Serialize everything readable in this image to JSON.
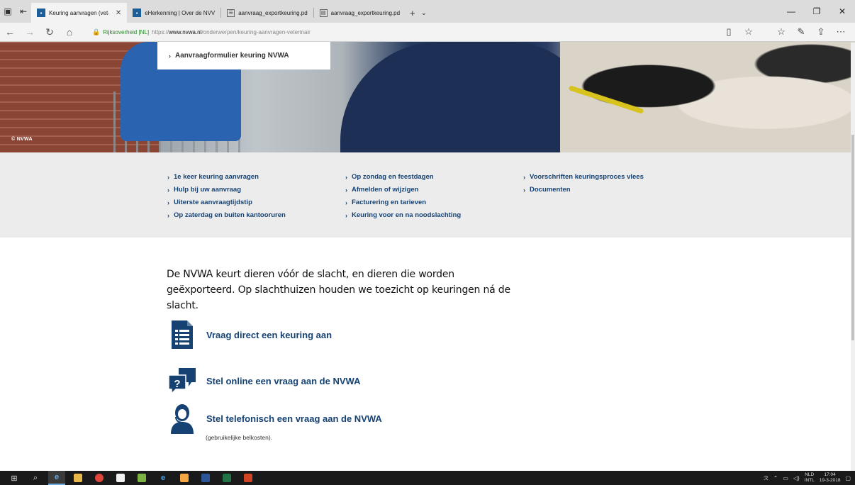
{
  "browser": {
    "tabs": [
      {
        "label": "Keuring aanvragen (vet·",
        "active": true,
        "icon": "nvwa-favicon"
      },
      {
        "label": "eHerkenning | Over de NVV",
        "active": false,
        "icon": "nvwa-favicon"
      },
      {
        "label": "aanvraag_exportkeuring.pd",
        "active": false,
        "icon": "document-icon"
      },
      {
        "label": "aanvraag_exportkeuring.pd",
        "active": false,
        "icon": "pdf-icon"
      }
    ],
    "address": {
      "org": "Rijksoverheid [NL]",
      "protocol": "https://",
      "host": "www.nvwa.nl",
      "path": "/onderwerpen/keuring-aanvragen-veterinair"
    }
  },
  "hero": {
    "credit": "© NVWA",
    "form_link": "Aanvraagformulier keuring NVWA"
  },
  "quick_links": {
    "col1": [
      "1e keer keuring aanvragen",
      "Hulp bij uw aanvraag",
      "Uiterste aanvraagtijdstip",
      "Op zaterdag en buiten kantooruren"
    ],
    "col2": [
      "Op zondag en feestdagen",
      "Afmelden of wijzigen",
      "Facturering en tarieven",
      "Keuring voor en na noodslachting"
    ],
    "col3": [
      "Voorschriften keuringsproces vlees",
      "Documenten"
    ]
  },
  "main": {
    "intro": "De NVWA keurt dieren vóór de slacht, en dieren die worden geëxporteerd. Op slachthuizen houden we toezicht op keuringen ná de slacht.",
    "actions": [
      {
        "label": "Vraag direct een keuring aan",
        "icon": "form-document-icon"
      },
      {
        "label": "Stel online een vraag aan de NVWA",
        "icon": "chat-question-icon"
      },
      {
        "label": "Stel telefonisch een vraag aan de NVWA",
        "icon": "phone-agent-icon"
      }
    ],
    "phone_note": "(gebruikelijke belkosten)."
  },
  "taskbar": {
    "lang_top": "NLD",
    "lang_bottom": "INTL",
    "time": "17:04",
    "date": "19-3-2018"
  },
  "colors": {
    "link": "#154273",
    "band": "#ececec",
    "icon": "#154273"
  }
}
